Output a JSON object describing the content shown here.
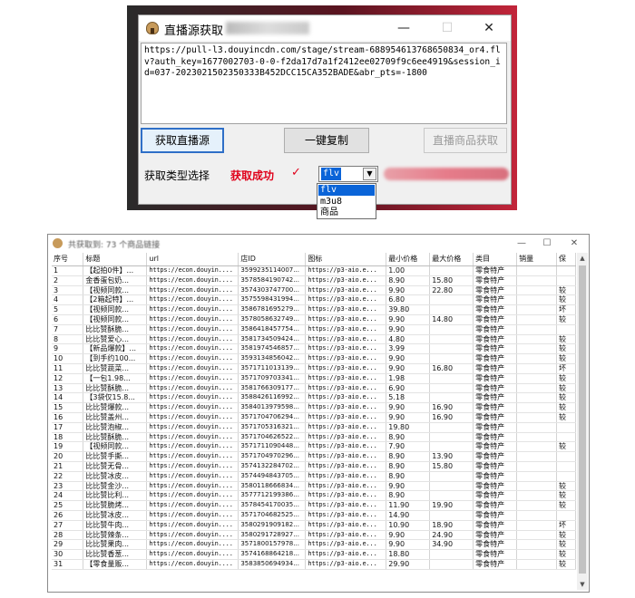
{
  "window1": {
    "title": "直播源获取",
    "minimize": "—",
    "maximize": "☐",
    "close": "✕",
    "url_text": "https://pull-l3.douyincdn.com/stage/stream-688954613768650834_or4.flv?auth_key=1677002703-0-0-f2da17d7a1f2412ee02709f9c6ee4919&session_id=037-2023021502350333B452DCC15CA352BADE&abr_pts=-1800",
    "btn_get_live": "获取直播源",
    "btn_copy": "一键复制",
    "btn_get_goods": "直播商品获取",
    "type_label": "获取类型选择",
    "status": "获取成功",
    "check": "✓",
    "select_value": "flv",
    "options": [
      "flv",
      "m3u8",
      "商品"
    ]
  },
  "window2": {
    "title": "共获取到: 73 个商品链接",
    "minimize": "—",
    "maximize": "☐",
    "close": "✕",
    "columns": [
      "序号",
      "标题",
      "url",
      "店ID",
      "图标",
      "最小价格",
      "最大价格",
      "类目",
      "销量",
      "保"
    ],
    "rows": [
      [
        "1",
        "【起拍0件】...",
        "https://econ.douyin....",
        "3599235114007...",
        "https://p3-aio.e...",
        "1.00",
        "",
        "零食特产",
        "",
        ""
      ],
      [
        "2",
        "金香蛋包奶...",
        "https://econ.douyin....",
        "3578584190742...",
        "https://p3-aio.e...",
        "8.90",
        "15.80",
        "零食特产",
        "",
        ""
      ],
      [
        "3",
        "【视频同款...",
        "https://econ.douyin....",
        "3574303747700...",
        "https://p3-aio.e...",
        "9.90",
        "22.80",
        "零食特产",
        "",
        "较"
      ],
      [
        "4",
        "【2箱起特】...",
        "https://econ.douyin....",
        "3575598431994...",
        "https://p3-aio.e...",
        "6.80",
        "",
        "零食特产",
        "",
        "较"
      ],
      [
        "5",
        "【视频同款...",
        "https://econ.douyin....",
        "3586781695279...",
        "https://p3-aio.e...",
        "39.80",
        "",
        "零食特产",
        "",
        "坏"
      ],
      [
        "6",
        "【视频同款...",
        "https://econ.douyin....",
        "3578058632749...",
        "https://p3-aio.e...",
        "9.90",
        "14.80",
        "零食特产",
        "",
        "较"
      ],
      [
        "7",
        "比比赞酥脆...",
        "https://econ.douyin....",
        "3586418457754...",
        "https://p3-aio.e...",
        "9.90",
        "",
        "零食特产",
        "",
        ""
      ],
      [
        "8",
        "比比赞爱心...",
        "https://econ.douyin....",
        "3581734509424...",
        "https://p3-aio.e...",
        "4.80",
        "",
        "零食特产",
        "",
        "较"
      ],
      [
        "9",
        "【新品爆款】...",
        "https://econ.douyin....",
        "3581974546857...",
        "https://p3-aio.e...",
        "3.99",
        "",
        "零食特产",
        "",
        "较"
      ],
      [
        "10",
        "【到手约100...",
        "https://econ.douyin....",
        "3593134856042...",
        "https://p3-aio.e...",
        "9.90",
        "",
        "零食特产",
        "",
        "较"
      ],
      [
        "11",
        "比比赞蔬菜...",
        "https://econ.douyin....",
        "3571711013139...",
        "https://p3-aio.e...",
        "9.90",
        "16.80",
        "零食特产",
        "",
        "坏"
      ],
      [
        "12",
        "【一包1.98...",
        "https://econ.douyin....",
        "3571709703341...",
        "https://p3-aio.e...",
        "1.98",
        "",
        "零食特产",
        "",
        "较"
      ],
      [
        "13",
        "比比赞酥脆...",
        "https://econ.douyin....",
        "3581766309177...",
        "https://p3-aio.e...",
        "6.90",
        "",
        "零食特产",
        "",
        "较"
      ],
      [
        "14",
        "【3袋仅15.8...",
        "https://econ.douyin....",
        "3588426116992...",
        "https://p3-aio.e...",
        "5.18",
        "",
        "零食特产",
        "",
        "较"
      ],
      [
        "15",
        "比比赞爆款...",
        "https://econ.douyin....",
        "3584013979598...",
        "https://p3-aio.e...",
        "9.90",
        "16.90",
        "零食特产",
        "",
        "较"
      ],
      [
        "16",
        "比比赞盖州...",
        "https://econ.douyin....",
        "3571704706294...",
        "https://p3-aio.e...",
        "9.90",
        "16.90",
        "零食特产",
        "",
        "较"
      ],
      [
        "17",
        "比比赞泡椒...",
        "https://econ.douyin....",
        "3571705316321...",
        "https://p3-aio.e...",
        "19.80",
        "",
        "零食特产",
        "",
        ""
      ],
      [
        "18",
        "比比赞酥脆...",
        "https://econ.douyin....",
        "3571704626522...",
        "https://p3-aio.e...",
        "8.90",
        "",
        "零食特产",
        "",
        ""
      ],
      [
        "19",
        "【视频同款...",
        "https://econ.douyin....",
        "3571711090448...",
        "https://p3-aio.e...",
        "7.90",
        "",
        "零食特产",
        "",
        "较"
      ],
      [
        "20",
        "比比赞手撕...",
        "https://econ.douyin....",
        "3571704970296...",
        "https://p3-aio.e...",
        "8.90",
        "13.90",
        "零食特产",
        "",
        ""
      ],
      [
        "21",
        "比比赞无骨...",
        "https://econ.douyin....",
        "3574132284702...",
        "https://p3-aio.e...",
        "8.90",
        "15.80",
        "零食特产",
        "",
        ""
      ],
      [
        "22",
        "比比赞冰皮...",
        "https://econ.douyin....",
        "3574494843705...",
        "https://p3-aio.e...",
        "8.90",
        "",
        "零食特产",
        "",
        ""
      ],
      [
        "23",
        "比比赞金沙...",
        "https://econ.douyin....",
        "3580118666834...",
        "https://p3-aio.e...",
        "9.90",
        "",
        "零食特产",
        "",
        "较"
      ],
      [
        "24",
        "比比赞比利...",
        "https://econ.douyin....",
        "3577712199386...",
        "https://p3-aio.e...",
        "8.90",
        "",
        "零食特产",
        "",
        "较"
      ],
      [
        "25",
        "比比赞脆烤...",
        "https://econ.douyin....",
        "3578454170035...",
        "https://p3-aio.e...",
        "11.90",
        "19.90",
        "零食特产",
        "",
        "较"
      ],
      [
        "26",
        "比比赞冰皮...",
        "https://econ.douyin....",
        "3571704682525...",
        "https://p3-aio.e...",
        "14.90",
        "",
        "零食特产",
        "",
        ""
      ],
      [
        "27",
        "比比赞牛肉...",
        "https://econ.douyin....",
        "3580291909182...",
        "https://p3-aio.e...",
        "10.90",
        "18.90",
        "零食特产",
        "",
        "坏"
      ],
      [
        "28",
        "比比赞辣条...",
        "https://econ.douyin....",
        "3580291728927...",
        "https://p3-aio.e...",
        "9.90",
        "24.90",
        "零食特产",
        "",
        "较"
      ],
      [
        "29",
        "比比赞果肉...",
        "https://econ.douyin....",
        "3571800157978...",
        "https://p3-aio.e...",
        "9.90",
        "34.90",
        "零食特产",
        "",
        "较"
      ],
      [
        "30",
        "比比赞香葱...",
        "https://econ.douyin....",
        "3574168864218...",
        "https://p3-aio.e...",
        "18.80",
        "",
        "零食特产",
        "",
        "较"
      ],
      [
        "31",
        "【零食量贩...",
        "https://econ.douyin....",
        "3583850694934...",
        "https://p3-aio.e...",
        "29.90",
        "",
        "零食特产",
        "",
        "较"
      ]
    ]
  }
}
